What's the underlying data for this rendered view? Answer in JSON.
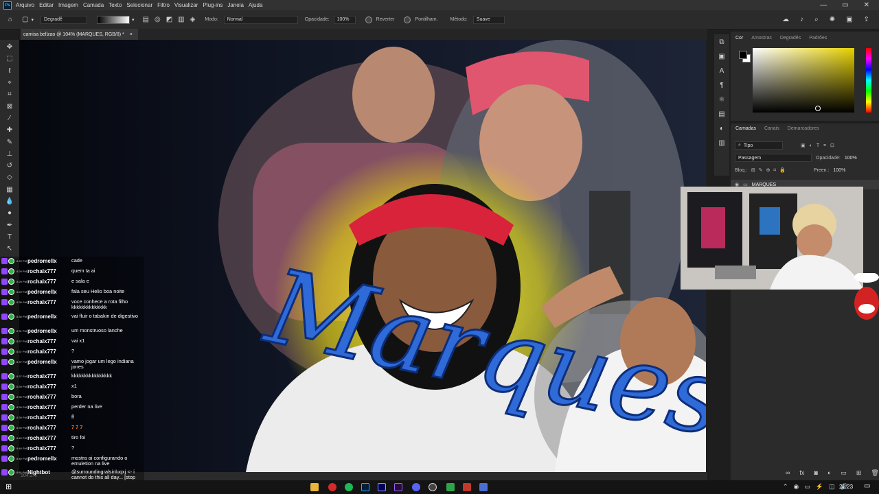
{
  "menubar": {
    "app_icon": "Ps",
    "items": [
      "Arquivo",
      "Editar",
      "Imagem",
      "Camada",
      "Texto",
      "Selecionar",
      "Filtro",
      "Visualizar",
      "Plug-ins",
      "Janela",
      "Ajuda"
    ]
  },
  "options": {
    "home_icon": "home-icon",
    "tool_preset": "Degradê",
    "mode_label": "Modo:",
    "mode_value": "Normal",
    "opacity_label": "Opacidade:",
    "opacity_value": "100%",
    "reverse_label": "Reverter",
    "dither_label": "Pontilham.",
    "method_label": "Método:",
    "method_value": "Suave"
  },
  "document": {
    "tab_title": "camisa bellzao @ 104% (MARQUES, RGB/8) *",
    "close": "×",
    "zoom_status": "104.2%"
  },
  "canvas_art": {
    "script_text": "Marques"
  },
  "color_panel": {
    "tabs": [
      "Cor",
      "Amostras",
      "Degradês",
      "Padrões"
    ],
    "foreground": "#000000",
    "background": "#ffffff",
    "hue_selected": "#e7d100"
  },
  "layers_panel": {
    "tabs": [
      "Camadas",
      "Canais",
      "Demarcadores"
    ],
    "filter_kind": "Tipo",
    "blend_mode": "Passagem",
    "opacity_label": "Opacidade:",
    "opacity_value": "100%",
    "lock_label": "Bloq.:",
    "fill_label": "Preen.:",
    "fill_value": "100%",
    "layer_name": "MARQUES",
    "footer_icons": [
      "link-icon",
      "fx-icon",
      "mask-icon",
      "adjustment-icon",
      "group-icon",
      "new-layer-icon",
      "trash-icon"
    ]
  },
  "chat": {
    "messages": [
      {
        "time": "8:29 PM",
        "user": "pedromellx",
        "text": "cade"
      },
      {
        "time": "8:29 PM",
        "user": "rochalx777",
        "text": "quem ta ai"
      },
      {
        "time": "8:29 PM",
        "user": "rochalx777",
        "text": "e sala e"
      },
      {
        "time": "8:29 PM",
        "user": "pedromellx",
        "text": "fala seu Helio boa noite"
      },
      {
        "time": "8:30 PM",
        "user": "rochalx777",
        "text": "voce conhece a rota filho kkkkkkkkkkkkkk"
      },
      {
        "time": "8:30 PM",
        "user": "pedromellx",
        "text": "vai fluir o tabakin de digestivo"
      },
      {
        "time": "8:31 PM",
        "user": "pedromellx",
        "text": "um monstruoso lanche"
      },
      {
        "time": "8:37 PM",
        "user": "rochalx777",
        "text": "vai x1"
      },
      {
        "time": "8:37 PM",
        "user": "rochalx777",
        "text": "?"
      },
      {
        "time": "8:37 PM",
        "user": "pedromellx",
        "text": "vamo jogar um lego indiana jones"
      },
      {
        "time": "8:37 PM",
        "user": "rochalx777",
        "text": "kkkkkkkkkkkkkkkk"
      },
      {
        "time": "8:39 PM",
        "user": "rochalx777",
        "text": "x1"
      },
      {
        "time": "8:39 PM",
        "user": "rochalx777",
        "text": "bora"
      },
      {
        "time": "8:39 PM",
        "user": "rochalx777",
        "text": "perder na live"
      },
      {
        "time": "8:39 PM",
        "user": "rochalx777",
        "text": "ff"
      },
      {
        "time": "8:39 PM",
        "user": "rochalx777",
        "text": "7 7 7"
      },
      {
        "time": "8:40 PM",
        "user": "rochalx777",
        "text": "tiro foi"
      },
      {
        "time": "8:40 PM",
        "user": "rochalx777",
        "text": "?"
      },
      {
        "time": "8:40 PM",
        "user": "pedromellx",
        "text": "mostra ai configurando o emuletion na live"
      },
      {
        "time": "8:51 PM",
        "user": "Nightbot",
        "text": "@surroundingralsinluqxj <- i cannot do this all day... [stop posting links] [warning]"
      }
    ]
  },
  "taskbar": {
    "clock": "21:23",
    "app_icons": [
      "folder-icon",
      "opera-icon",
      "spotify-icon",
      "photoshop-icon",
      "after-effects-icon",
      "premiere-icon",
      "discord-icon",
      "obs-icon",
      "app-icon",
      "app-icon",
      "app-icon"
    ]
  }
}
